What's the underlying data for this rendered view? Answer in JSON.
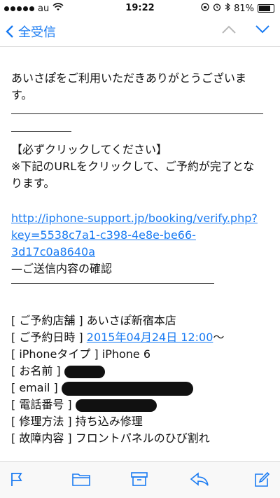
{
  "status": {
    "carrier": "au",
    "time": "19:22",
    "battery": "81%",
    "battery_level": 0.81
  },
  "nav": {
    "back_label": "全受信"
  },
  "email": {
    "greeting_line1": "あいさぽをご利用いただきありがとうございま",
    "greeting_line2": "す。",
    "notice_title": "【必ずクリックしてください】",
    "notice_line1": "※下記のURLをクリックして、ご予約が完了とな",
    "notice_line2": "ります。",
    "url_line1": "http://iphone-support.jp/booking/verify.php?",
    "url_line2": "key=5538c7a1-c398-4e8e-be66-3d17c0a8640a",
    "confirm_heading": "—ご送信内容の確認",
    "fields": [
      {
        "label": "[ ご予約店舗 ]",
        "value": "あいさぽ新宿本店"
      },
      {
        "label": "[ ご予約日時 ]",
        "value": "2015年04月24日 12:00",
        "suffix": "〜"
      },
      {
        "label": "[ iPhoneタイプ ]",
        "value": "iPhone 6"
      },
      {
        "label": "[ お名前 ]",
        "value": ""
      },
      {
        "label": "[ email ]",
        "value": ""
      },
      {
        "label": "[ 電話番号 ]",
        "value": ""
      },
      {
        "label": "[ 修理方法 ]",
        "value": "持ち込み修理"
      },
      {
        "label": "[ 故障内容 ]",
        "value": "フロントパネルのひび割れ"
      }
    ]
  },
  "colors": {
    "accent": "#1a7bf2"
  },
  "icons": {
    "toolbar": [
      "flag-icon",
      "folder-icon",
      "archive-icon",
      "reply-icon",
      "compose-icon"
    ]
  }
}
